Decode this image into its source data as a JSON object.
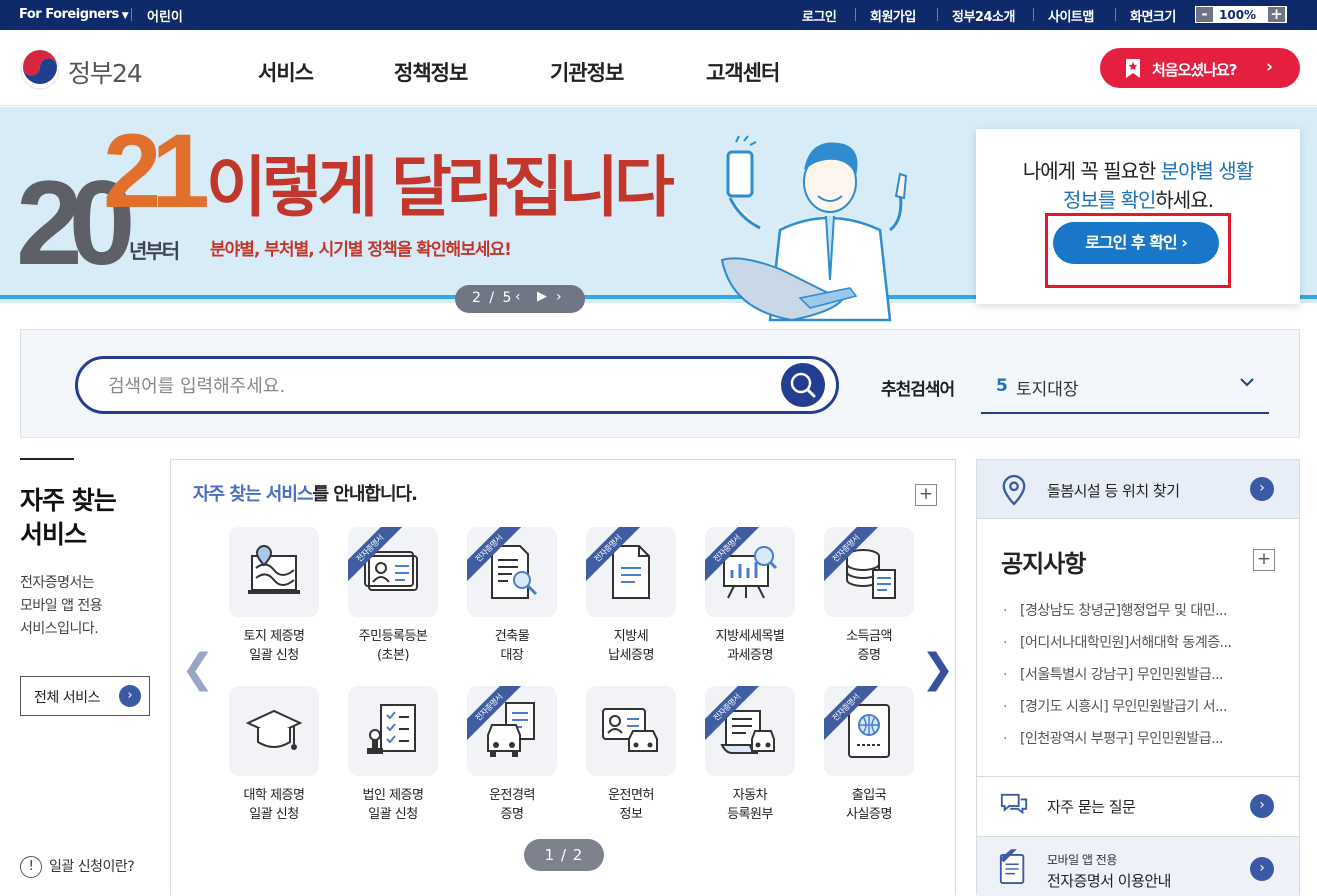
{
  "topbar": {
    "lang": "For Foreigners",
    "kids": "어린이",
    "links": [
      "로그인",
      "회원가입",
      "정부24소개",
      "사이트맵",
      "화면크기"
    ],
    "zoom_value": "100%",
    "zoom_minus": "-",
    "zoom_plus": "+"
  },
  "header": {
    "logo_text": "정부24",
    "nav": [
      "서비스",
      "정책정보",
      "기관정보",
      "고객센터"
    ],
    "first_visit_label": "처음오셨나요?"
  },
  "banner": {
    "year_a": "20",
    "year_b": "21",
    "year_suffix": "년부터",
    "title": "이렇게 달라집니다",
    "subtitle": "분야별, 부처별, 시기별 정책을 확인해보세요!",
    "pager": "2 / 5"
  },
  "login_card": {
    "text_1": "나에게 꼭 필요한 ",
    "text_hl1": "분야별 생활",
    "text_hl2": "정보를 확인",
    "text_2": "하세요.",
    "button": "로그인 후 확인 ›"
  },
  "search": {
    "placeholder": "검색어를 입력해주세요.",
    "rec_label": "추천검색어",
    "rec_num": "5",
    "rec_term": "토지대장"
  },
  "left": {
    "title_1": "자주 찾는",
    "title_2": "서비스",
    "desc_1": "전자증명서는",
    "desc_2": "모바일 앱 전용",
    "desc_3": "서비스입니다.",
    "all_button": "전체 서비스",
    "faq": "일괄 신청이란?"
  },
  "services": {
    "title_hl": "자주 찾는 서비스",
    "title_rest": "를 안내합니다.",
    "ribbon": "전자증명서",
    "page": "1 / 2",
    "items": [
      {
        "l1": "토지 제증명",
        "l2": "일괄 신청",
        "icon": "map-icon",
        "ribbon": false
      },
      {
        "l1": "주민등록등본",
        "l2": "(초본)",
        "icon": "id-card-icon",
        "ribbon": true
      },
      {
        "l1": "건축물",
        "l2": "대장",
        "icon": "document-search-icon",
        "ribbon": true
      },
      {
        "l1": "지방세",
        "l2": "납세증명",
        "icon": "document-icon",
        "ribbon": true
      },
      {
        "l1": "지방세세목별",
        "l2": "과세증명",
        "icon": "chart-board-icon",
        "ribbon": true
      },
      {
        "l1": "소득금액",
        "l2": "증명",
        "icon": "coins-document-icon",
        "ribbon": true
      },
      {
        "l1": "대학 제증명",
        "l2": "일괄 신청",
        "icon": "graduation-cap-icon",
        "ribbon": false
      },
      {
        "l1": "법인 제증명",
        "l2": "일괄 신청",
        "icon": "checklist-stamp-icon",
        "ribbon": false
      },
      {
        "l1": "운전경력",
        "l2": "증명",
        "icon": "car-document-icon",
        "ribbon": true
      },
      {
        "l1": "운전면허",
        "l2": "정보",
        "icon": "license-car-icon",
        "ribbon": false
      },
      {
        "l1": "자동차",
        "l2": "등록원부",
        "icon": "car-scroll-icon",
        "ribbon": true
      },
      {
        "l1": "출입국",
        "l2": "사실증명",
        "icon": "passport-icon",
        "ribbon": true
      }
    ]
  },
  "right": {
    "location": "돌봄시설 등 위치 찾기",
    "notice_title": "공지사항",
    "notices": [
      "[경상남도 창녕군]행정업무 및 대민...",
      "[어디서나대학민원]서해대학 동계증...",
      "[서울특별시 강남구] 무인민원발급...",
      "[경기도 시흥시] 무인민원발급기 서...",
      "[인천광역시 부평구] 무인민원발급..."
    ],
    "faq": "자주 묻는 질문",
    "mobile_1": "모바일 앱 전용",
    "mobile_2": "전자증명서 이용안내"
  },
  "colors": {
    "topbar": "#0f2a6a",
    "accent_red": "#e41f3f",
    "search_blue": "#233d92",
    "highlight_blue": "#1e73b8"
  }
}
